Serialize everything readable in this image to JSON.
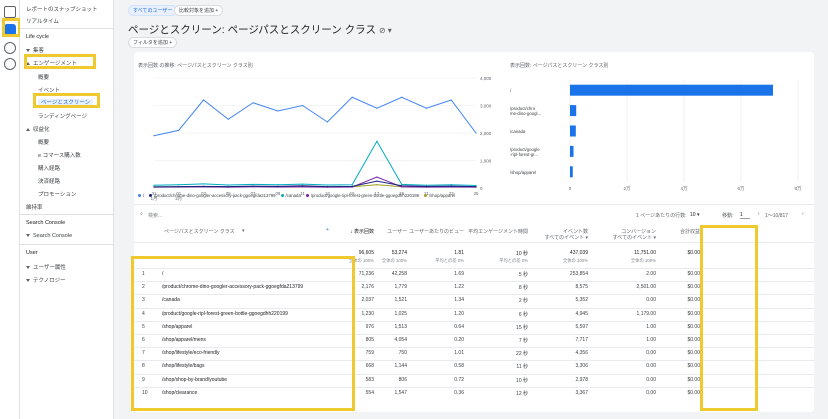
{
  "sidebar": {
    "snapshot": "レポートのスナップショット",
    "realtime": "リアルタイム",
    "lifecycle": "Life cycle",
    "acquisition": "集客",
    "engagement": "エンゲージメント",
    "overview": "概要",
    "events": "イベント",
    "pages_screens": "ページとスクリーン",
    "landing": "ランディングページ",
    "monetization": "収益化",
    "mon_overview": "概要",
    "ecommerce": "e コマース購入数",
    "purchase_journey": "購入経路",
    "checkout_journey": "決済経路",
    "promotions": "プロモーション",
    "retention": "維持率",
    "search_console_section": "Search Console",
    "search_console_item": "Search Console",
    "user_section": "User",
    "user_attributes": "ユーザー属性",
    "technology": "テクノロジー"
  },
  "header": {
    "segment_chip": "すべてのユーザー",
    "compare_chip": "比較対象を追加 +",
    "title": "ページとスクリーン: ページパスとスクリーン クラス",
    "filter_chip": "フィルタを追加 +"
  },
  "line_chart": {
    "title": "表示回数 の推移: ページパスとスクリーン クラス別",
    "x_ticks": [
      "31\n1月",
      "01\n2月",
      "02",
      "03",
      "04",
      "05",
      "06",
      "07",
      "08",
      "09",
      "10",
      "11",
      "12",
      "13",
      "14",
      "15",
      "16",
      "17",
      "18",
      "19",
      "20",
      "21",
      "22",
      "23",
      "24",
      "25",
      "26",
      "27",
      "28",
      "29",
      "30"
    ],
    "x_visible_ticks": [
      "31\n1月",
      "01\n2月",
      "03",
      "05",
      "07",
      "09",
      "11",
      "13",
      "15",
      "17",
      "19",
      "21",
      "23",
      "25"
    ],
    "y_ticks": [
      "4,000",
      "3,000",
      "2,000",
      "1,000",
      "0"
    ],
    "legend": [
      "/",
      "/product/chrome-dino-googler-accessory-pack-ggoegfda213799",
      "/canada",
      "/product/google-ripl-forest-green-bottle-ggoegdhh220199",
      "/shop/apparel"
    ],
    "colors": [
      "#4285f4",
      "#1a237e",
      "#00acc1",
      "#7b1fa2",
      "#9e9d24"
    ]
  },
  "chart_data": [
    {
      "type": "line",
      "title": "表示回数 の推移: ページパスとスクリーン クラス別",
      "x": [
        "31",
        "01",
        "03",
        "05",
        "07",
        "09",
        "11",
        "13",
        "15",
        "17",
        "19",
        "21",
        "23",
        "25"
      ],
      "ylim": [
        0,
        4000
      ],
      "series": [
        {
          "name": "/",
          "values": [
            1900,
            2100,
            3200,
            2500,
            3100,
            2800,
            3000,
            2400,
            3300,
            2900,
            3300,
            2900,
            3200,
            2000
          ]
        },
        {
          "name": "/product/chrome-dino-googler-accessory-pack-ggoegfda213799",
          "values": [
            40,
            50,
            60,
            50,
            70,
            60,
            80,
            50,
            60,
            250,
            80,
            60,
            70,
            50
          ]
        },
        {
          "name": "/canada",
          "values": [
            100,
            120,
            150,
            110,
            130,
            120,
            140,
            110,
            120,
            1700,
            130,
            100,
            120,
            90
          ]
        },
        {
          "name": "/product/google-ripl-forest-green-bottle-ggoegdhh220199",
          "values": [
            30,
            35,
            40,
            30,
            45,
            35,
            40,
            30,
            35,
            400,
            40,
            30,
            35,
            30
          ]
        },
        {
          "name": "/shop/apparel",
          "values": [
            40,
            45,
            50,
            40,
            50,
            45,
            48,
            40,
            45,
            120,
            45,
            40,
            45,
            40
          ]
        }
      ]
    },
    {
      "type": "bar",
      "title": "表示回数: ページパスとスクリーン クラス別",
      "categories": [
        "/",
        "/product/chrome-dino-googler-accessory-pack-ggoegfda213799",
        "/canada",
        "/product/google-ripl-forest-green-bottle-ggoegdhh220199",
        "/shop/apparel"
      ],
      "values": [
        71236,
        2176,
        2037,
        1230,
        976
      ],
      "xlim": [
        0,
        80000
      ]
    }
  ],
  "bar_chart": {
    "title": "表示回数: ページパスとスクリーン クラス別",
    "labels": [
      "/",
      "/product/chro\nme-dino-googl...",
      "/canada",
      "/product/google\n-ripl-forest-gr...",
      "/shop/apparel"
    ],
    "x_ticks": [
      "0",
      "2万",
      "4万",
      "6万",
      "8万"
    ]
  },
  "table": {
    "search_placeholder": "検索...",
    "rows_per_page_label": "1 ページあたりの行数:",
    "rows_per_page": "10",
    "goto_label": "移動:",
    "goto_value": "1",
    "range": "1～10/817",
    "dim_header": "ページパスとスクリーン クラス",
    "headers": [
      "↓ 表示回数",
      "ユーザー",
      "ユーザーあたりのビュー",
      "平均エンゲージメント時間",
      "イベント数\nすべてのイベント ▾",
      "コンバージョン\nすべてのイベント ▾",
      "合計収益"
    ],
    "totals": [
      "96,605",
      "53,274",
      "1.81",
      "10 秒",
      "437,039",
      "11,751.00",
      "$0.00"
    ],
    "totals_sub": [
      "全体の 100%",
      "全体の 100%",
      "平均との差 0%",
      "平均との差 0%",
      "全体の 100%",
      "全体の 100%",
      ""
    ],
    "rows": [
      {
        "n": "1",
        "path": "/",
        "v": [
          "71,236",
          "42,258",
          "1.69",
          "5 秒",
          "253,854",
          "2.00",
          "$0.00"
        ]
      },
      {
        "n": "2",
        "path": "/product/chrome-dino-googler-accessory-pack-ggoegfda213799",
        "v": [
          "2,176",
          "1,779",
          "1.22",
          "8 秒",
          "8,575",
          "2,501.00",
          "$0.00"
        ]
      },
      {
        "n": "3",
        "path": "/canada",
        "v": [
          "2,037",
          "1,521",
          "1.34",
          "2 秒",
          "5,352",
          "0.00",
          "$0.00"
        ]
      },
      {
        "n": "4",
        "path": "/product/google-ripl-forest-green-bottle-ggoegdhh220199",
        "v": [
          "1,230",
          "1,025",
          "1.20",
          "6 秒",
          "4,945",
          "1,179.00",
          "$0.00"
        ]
      },
      {
        "n": "5",
        "path": "/shop/apparel",
        "v": [
          "976",
          "1,513",
          "0.64",
          "15 秒",
          "5,597",
          "1.00",
          "$0.00"
        ]
      },
      {
        "n": "6",
        "path": "/shop/apparel/mens",
        "v": [
          "805",
          "4,054",
          "0.20",
          "7 秒",
          "7,717",
          "1.00",
          "$0.00"
        ]
      },
      {
        "n": "7",
        "path": "/shop/lifestyle/eco-friendly",
        "v": [
          "759",
          "750",
          "1.01",
          "22 秒",
          "4,356",
          "0.00",
          "$0.00"
        ]
      },
      {
        "n": "8",
        "path": "/shop/lifestyle/bags",
        "v": [
          "668",
          "1,144",
          "0.58",
          "11 秒",
          "3,306",
          "0.00",
          "$0.00"
        ]
      },
      {
        "n": "9",
        "path": "/shop/shop-by-brand/youtube",
        "v": [
          "583",
          "806",
          "0.72",
          "10 秒",
          "2,978",
          "0.00",
          "$0.00"
        ]
      },
      {
        "n": "10",
        "path": "/shop/clearance",
        "v": [
          "554",
          "1,547",
          "0.36",
          "12 秒",
          "3,367",
          "0.00",
          "$0.00"
        ]
      }
    ]
  }
}
